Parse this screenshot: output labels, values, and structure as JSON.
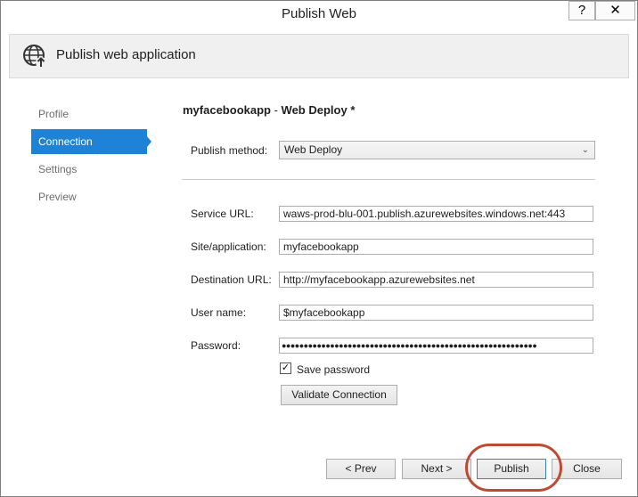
{
  "window": {
    "title": "Publish Web",
    "help_label": "?",
    "close_label": "✕"
  },
  "header": {
    "title": "Publish web application",
    "icon": "globe-publish-icon"
  },
  "sidebar": {
    "items": [
      {
        "label": "Profile",
        "active": false
      },
      {
        "label": "Connection",
        "active": true
      },
      {
        "label": "Settings",
        "active": false
      },
      {
        "label": "Preview",
        "active": false
      }
    ]
  },
  "main": {
    "profile_name": "myfacebookapp",
    "profile_separator": " - ",
    "profile_type": "Web Deploy *",
    "publish_method_label": "Publish method:",
    "publish_method_value": "Web Deploy",
    "service_url_label": "Service URL:",
    "service_url_value": "waws-prod-blu-001.publish.azurewebsites.windows.net:443",
    "site_label": "Site/application:",
    "site_value": "myfacebookapp",
    "destination_label": "Destination URL:",
    "destination_value": "http://myfacebookapp.azurewebsites.net",
    "username_label": "User name:",
    "username_value": "$myfacebookapp",
    "password_label": "Password:",
    "password_value": "●●●●●●●●●●●●●●●●●●●●●●●●●●●●●●●●●●●●●●●●●●●●●●●●●●●●●●●●●●",
    "save_password_label": "Save password",
    "save_password_checked": true,
    "validate_label": "Validate Connection"
  },
  "footer": {
    "prev_label": "< Prev",
    "next_label": "Next >",
    "publish_label": "Publish",
    "close_label": "Close"
  },
  "colors": {
    "accent": "#1e82d6",
    "highlight": "#bf4a32"
  }
}
